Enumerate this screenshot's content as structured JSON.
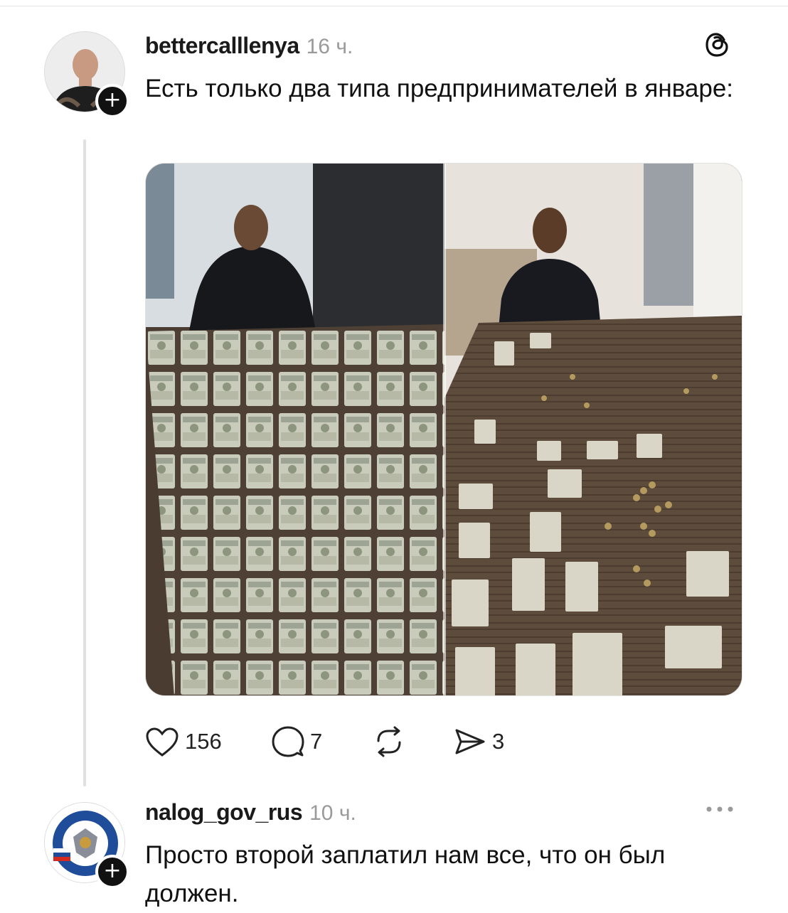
{
  "post": {
    "username": "bettercalllenya",
    "time": "16 ч.",
    "text": "Есть только два типа предпринимателей в январе:",
    "stats": {
      "likes": "156",
      "comments": "7",
      "shares": "3"
    }
  },
  "reply": {
    "username": "nalog_gov_rus",
    "time": "10 ч.",
    "text": "Просто второй заплатил нам все, что он был должен."
  },
  "icons": {
    "app": "threads-icon",
    "like": "heart-icon",
    "comment": "comment-icon",
    "repost": "repost-icon",
    "share": "share-icon",
    "more": "more-icon",
    "follow": "plus-icon"
  },
  "colors": {
    "text": "#111111",
    "muted": "#9a9a9a",
    "thread_line": "#e0e0e0"
  }
}
